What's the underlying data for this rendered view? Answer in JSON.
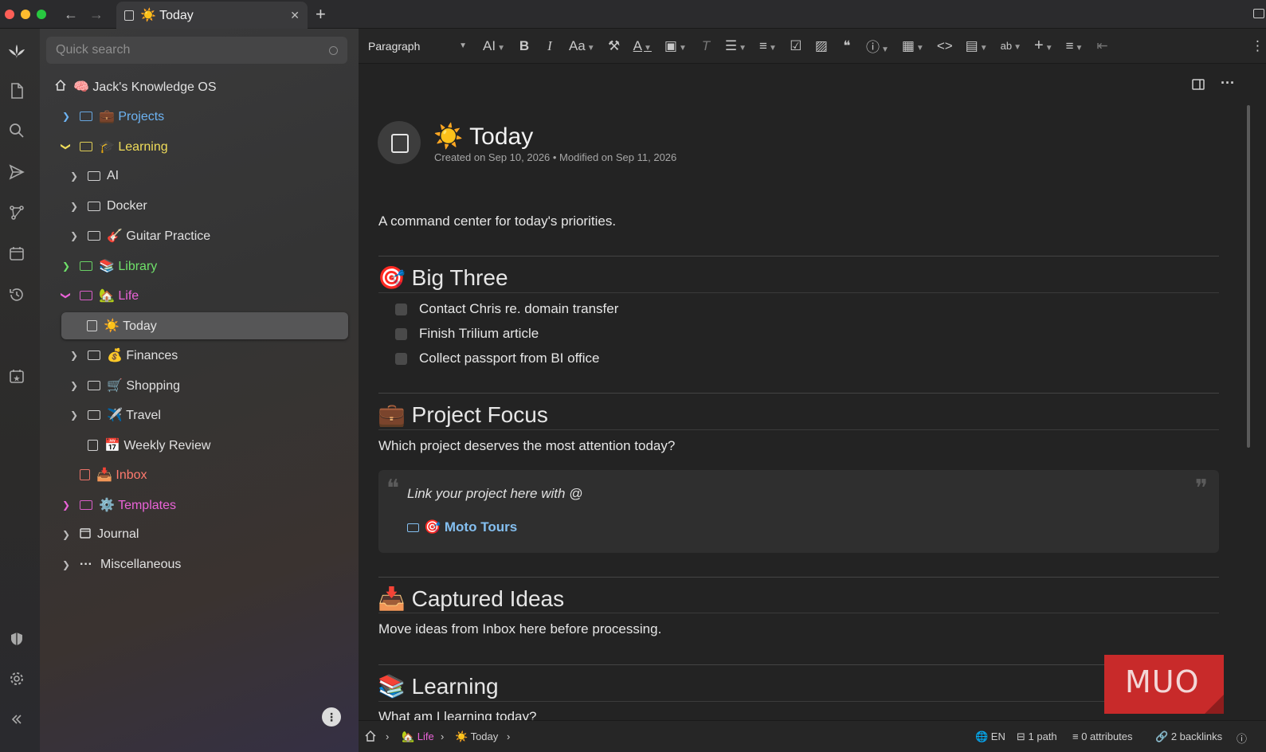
{
  "titlebar": {
    "tab_title": "☀️ Today",
    "tab_close": "✕",
    "new_tab": "+",
    "back": "←",
    "forward": "→"
  },
  "rail": {
    "icons": [
      "launcher-icon",
      "file-icon",
      "search-icon",
      "send-icon",
      "graph-icon",
      "calendar-icon",
      "history-icon",
      "today-icon",
      "shield-icon",
      "settings-icon",
      "collapse-icon"
    ]
  },
  "sidebar": {
    "search_placeholder": "Quick search",
    "root": "🧠 Jack's Knowledge OS",
    "items": [
      {
        "label": "💼 Projects",
        "color": "#6db3f2"
      },
      {
        "label": "🎓 Learning",
        "color": "#f0dd5a"
      },
      {
        "label": "AI",
        "color": "#e0e0e0"
      },
      {
        "label": "Docker",
        "color": "#e0e0e0"
      },
      {
        "label": "🎸 Guitar Practice",
        "color": "#e0e0e0"
      },
      {
        "label": "📚 Library",
        "color": "#6fe06a"
      },
      {
        "label": "🏡 Life",
        "color": "#ea63d8"
      },
      {
        "label": "☀️ Today",
        "color": "#e0e0e0"
      },
      {
        "label": "💰 Finances",
        "color": "#e0e0e0"
      },
      {
        "label": "🛒 Shopping",
        "color": "#e0e0e0"
      },
      {
        "label": "✈️ Travel",
        "color": "#e0e0e0"
      },
      {
        "label": "📅 Weekly Review",
        "color": "#e0e0e0"
      },
      {
        "label": "📥 Inbox",
        "color": "#ff7a6e"
      },
      {
        "label": "⚙️ Templates",
        "color": "#ea63d8"
      },
      {
        "label": "Journal",
        "color": "#e0e0e0"
      },
      {
        "label": "Miscellaneous",
        "color": "#e0e0e0"
      }
    ]
  },
  "toolbar": {
    "paragraph": "Paragraph"
  },
  "note": {
    "title": "☀️ Today",
    "meta": "Created on Sep 10, 2026 • Modified on Sep 11, 2026",
    "intro": "A command center for today's priorities.",
    "big_three": {
      "heading": "🎯 Big Three",
      "tasks": [
        "Contact Chris re. domain transfer",
        "Finish Trilium article",
        "Collect passport from BI office"
      ]
    },
    "project_focus": {
      "heading": "💼 Project Focus",
      "text": "Which project deserves the most attention today?",
      "quote": "Link your project here with @",
      "link": "🎯 Moto Tours"
    },
    "captured_ideas": {
      "heading": "📥 Captured Ideas",
      "text": "Move ideas from Inbox here before processing."
    },
    "learning": {
      "heading": "📚 Learning",
      "text": "What am I learning today?"
    }
  },
  "watermark": "MUO",
  "statusbar": {
    "crumb_life": "🏡 Life",
    "crumb_today": "☀️ Today",
    "lang": "🌐 EN",
    "paths": "1 path",
    "attributes": "0 attributes",
    "backlinks": "2 backlinks"
  }
}
